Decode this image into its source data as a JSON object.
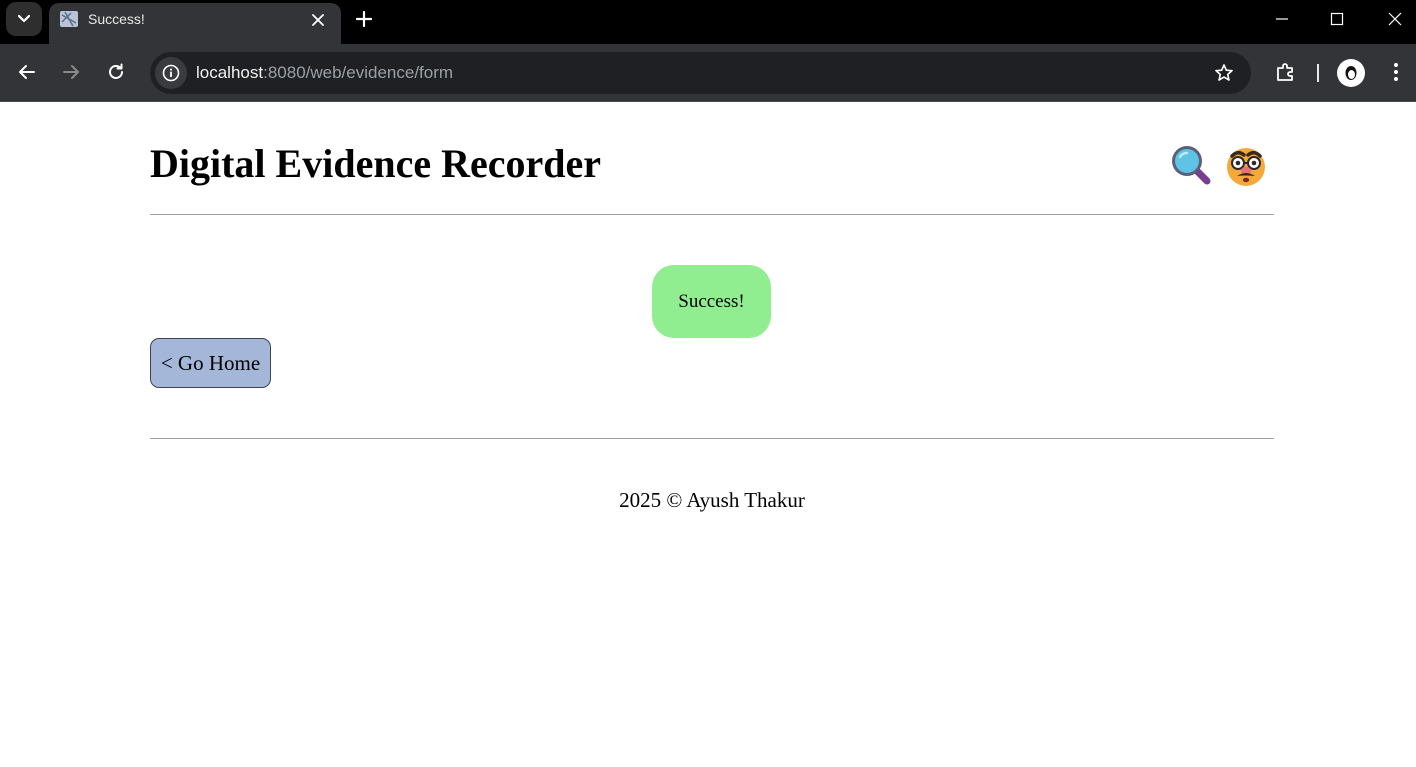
{
  "browser": {
    "tab": {
      "title": "Success!"
    },
    "address_bar": {
      "host": "localhost",
      "path": ":8080/web/evidence/form"
    }
  },
  "page": {
    "title": "Digital Evidence Recorder",
    "success_message": "Success!",
    "home_button_label": "< Go Home",
    "footer": "2025 © Ayush Thakur"
  },
  "colors": {
    "success_bg": "#90ee90",
    "home_button_bg": "#a4b7d8",
    "chrome_dark": "#000000",
    "chrome_toolbar": "#333437"
  },
  "icons": [
    "tab-search-icon",
    "favicon-icon",
    "close-icon",
    "plus-icon",
    "minimize-icon",
    "maximize-icon",
    "window-close-icon",
    "back-arrow-icon",
    "forward-arrow-icon",
    "reload-icon",
    "info-icon",
    "star-icon",
    "extensions-icon",
    "profile-icon",
    "more-vert-icon",
    "magnifying-glass-icon",
    "disguised-face-icon"
  ]
}
